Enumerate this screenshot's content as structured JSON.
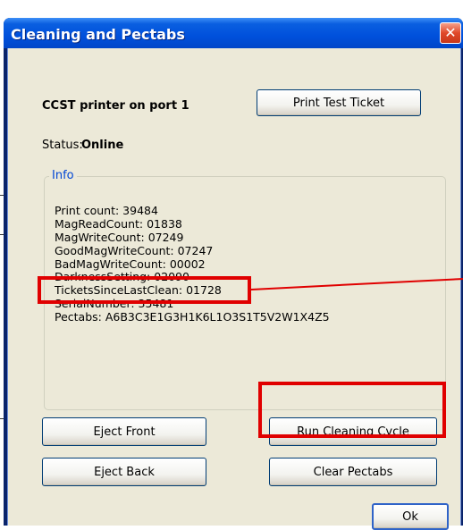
{
  "window": {
    "title": "Cleaning and Pectabs",
    "close_glyph": "✕"
  },
  "printer": {
    "name": "CCST printer on port 1",
    "print_test_label": "Print Test Ticket",
    "status_label": "Status:",
    "status_value": "Online"
  },
  "info": {
    "title": "Info",
    "lines": [
      "Print count: 39484",
      "MagReadCount: 01838",
      "MagWriteCount: 07249",
      "GoodMagWriteCount: 07247",
      "BadMagWriteCount: 00002",
      "DarknessSetting: 02090",
      "TicketsSinceLastClean: 01728",
      "SerialNumber: 35481",
      "Pectabs: A6B3C3E1G3H1K6L1O3S1T5V2W1X4Z5"
    ]
  },
  "buttons": {
    "eject_front": "Eject Front",
    "eject_back": "Eject Back",
    "run_cleaning": "Run Cleaning Cycle",
    "clear_pectabs": "Clear Pectabs",
    "ok": "Ok"
  },
  "colors": {
    "highlight": "#e00000",
    "group_title": "#0046d5",
    "titlebar": "#0050dc"
  },
  "icons": {
    "close": "close-icon"
  }
}
